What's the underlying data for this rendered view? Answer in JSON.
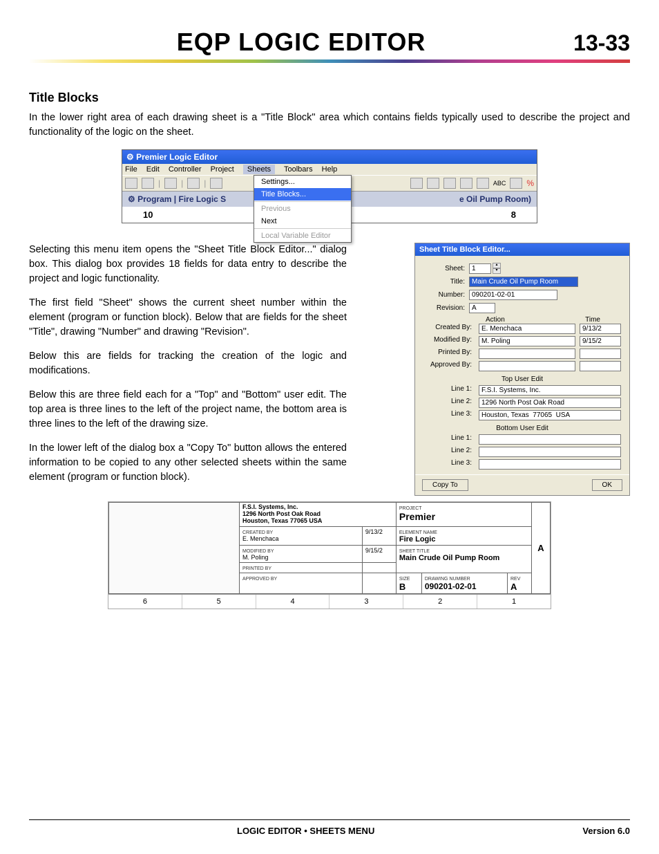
{
  "header": {
    "title": "EQP LOGIC EDITOR",
    "page_number": "13-33"
  },
  "section": {
    "title": "Title Blocks"
  },
  "paragraphs": {
    "p1": "In the lower right area of each drawing sheet is a \"Title Block\" area which contains fields typically used to describe the project and functionality of the logic on the sheet.",
    "p2": "Selecting this menu item opens the \"Sheet Title Block Editor...\" dialog box.  This dialog box provides 18 fields for data entry to describe the project and logic functionality.",
    "p3": "The first field \"Sheet\" shows the current sheet number within the element (program or function block).  Below that are fields for the sheet \"Title\", drawing \"Number\" and drawing \"Revision\".",
    "p4": "Below this are fields for tracking the creation of the logic and modifications.",
    "p5": "Below this are three field each for a \"Top\" and \"Bottom\" user edit.  The top area is three lines to the left of the project name, the bottom area is three lines to the left of the drawing size.",
    "p6": "In the lower left of the dialog box a \"Copy To\" button allows the entered information to be copied to any other selected sheets within the same element (program or function block)."
  },
  "app_window": {
    "title": "Premier Logic Editor",
    "menus": {
      "file": "File",
      "edit": "Edit",
      "controller": "Controller",
      "project": "Project",
      "sheets": "Sheets",
      "toolbars": "Toolbars",
      "help": "Help"
    },
    "sheets_menu": {
      "settings": "Settings...",
      "title_blocks": "Title Blocks...",
      "previous": "Previous",
      "next": "Next",
      "local_var": "Local Variable Editor"
    },
    "tab_left": "Program  |  Fire Logic S",
    "tab_right": "e Oil Pump Room)",
    "num_left": "10",
    "num_right": "8"
  },
  "dialog": {
    "title": "Sheet Title Block Editor...",
    "labels": {
      "sheet": "Sheet:",
      "title": "Title:",
      "number": "Number:",
      "revision": "Revision:",
      "action": "Action",
      "time": "Time",
      "created": "Created By:",
      "modified": "Modified By:",
      "printed": "Printed By:",
      "approved": "Approved By:",
      "top_edit": "Top User Edit",
      "bottom_edit": "Bottom User Edit",
      "line1": "Line 1:",
      "line2": "Line 2:",
      "line3": "Line 3:"
    },
    "values": {
      "sheet": "1",
      "title": "Main Crude Oil Pump Room",
      "number": "090201-02-01",
      "revision": "A",
      "created_by": "E. Menchaca",
      "created_time": "9/13/2",
      "modified_by": "M. Poling",
      "modified_time": "9/15/2",
      "printed_by": "",
      "printed_time": "",
      "approved_by": "",
      "approved_time": "",
      "top1": "F.S.I. Systems, Inc.",
      "top2": "1296 North Post Oak Road",
      "top3": "Houston, Texas  77065  USA",
      "bot1": "",
      "bot2": "",
      "bot3": ""
    },
    "buttons": {
      "copy_to": "Copy To",
      "ok": "OK"
    }
  },
  "title_block": {
    "company1": "F.S.I. Systems, Inc.",
    "company2": "1296 North Post Oak Road",
    "company3": "Houston, Texas 77065  USA",
    "created_lbl": "CREATED BY",
    "created_by": "E. Menchaca",
    "created_date": "9/13/2",
    "modified_lbl": "MODIFIED BY",
    "modified_by": "M. Poling",
    "modified_date": "9/15/2",
    "printed_lbl": "PRINTED BY",
    "approved_lbl": "APPROVED BY",
    "project_lbl": "PROJECT",
    "project": "Premier",
    "element_lbl": "ELEMENT NAME",
    "element": "Fire Logic",
    "sheet_title_lbl": "SHEET TITLE",
    "sheet_title": "Main Crude Oil Pump Room",
    "size_lbl": "SIZE",
    "size": "B",
    "drawing_lbl": "DRAWING NUMBER",
    "drawing": "090201-02-01",
    "rev_lbl": "REV",
    "rev": "A",
    "side": "A",
    "ruler": [
      "6",
      "5",
      "4",
      "3",
      "2",
      "1"
    ]
  },
  "footer": {
    "center": "Logic Editor • Sheets Menu",
    "version": "Version 6.0"
  }
}
